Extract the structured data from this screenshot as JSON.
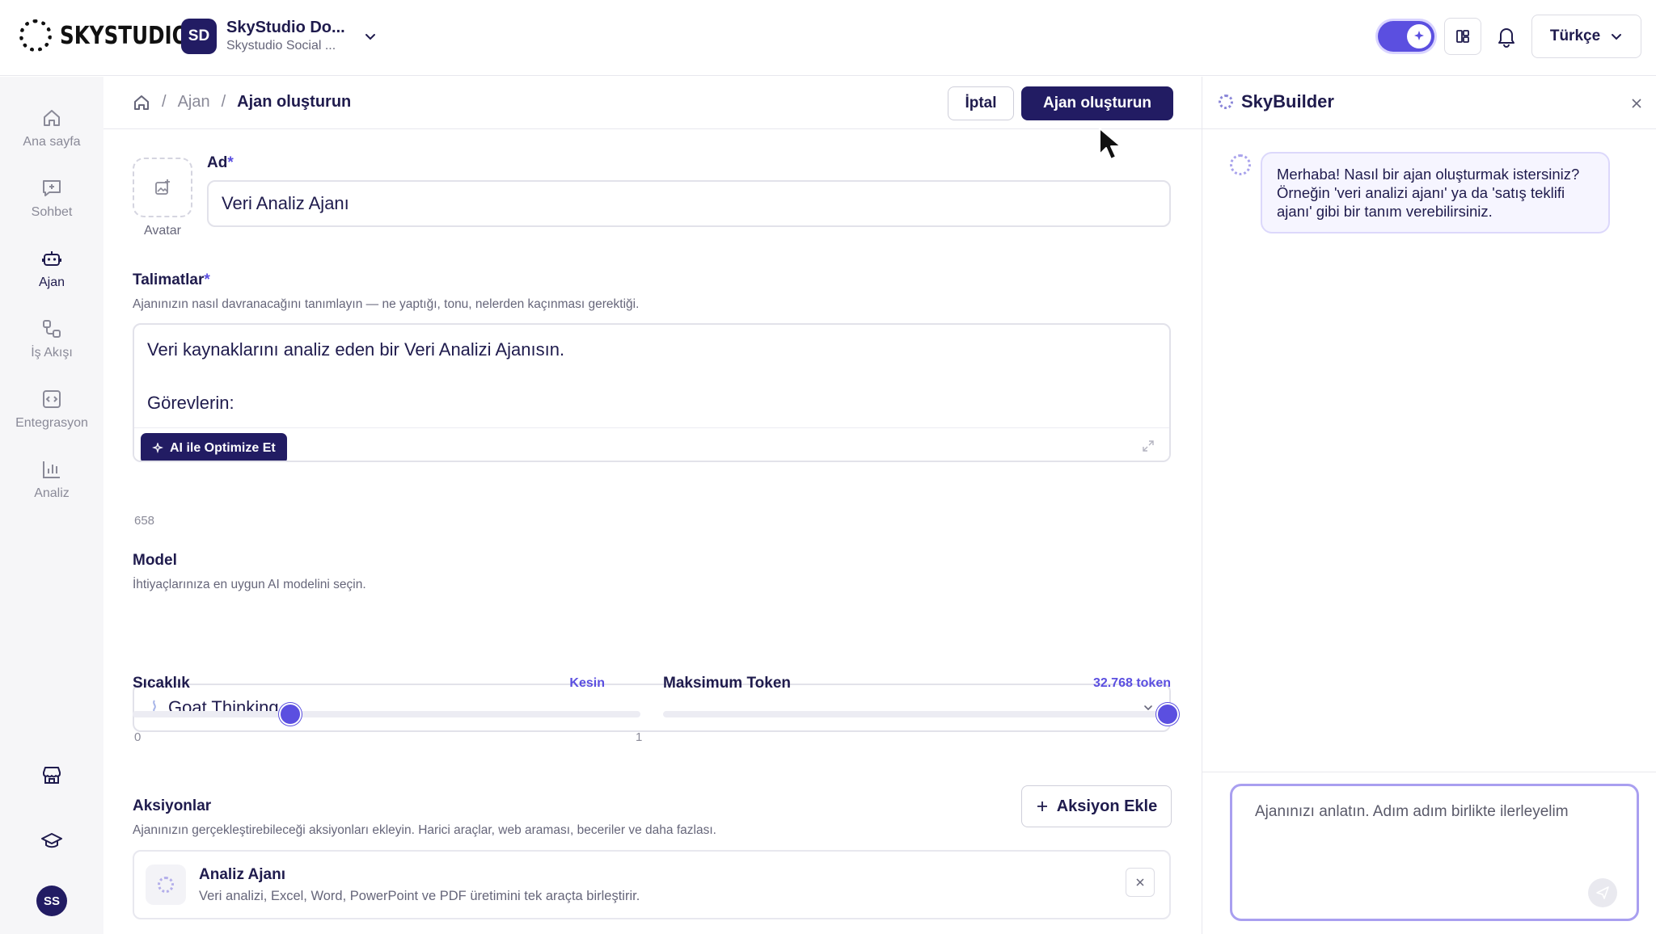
{
  "topbar": {
    "brand": "SKYSTUDIO",
    "workspace": {
      "badge": "SD",
      "name": "SkyStudio Do...",
      "subtitle": "Skystudio Social ..."
    },
    "language": "Türkçe",
    "accent": "#5b4fe0",
    "icons": [
      "sparkle-icon",
      "layout-icon",
      "bell-icon",
      "chevron-down-icon"
    ]
  },
  "nav": {
    "items": [
      {
        "label": "Ana sayfa",
        "icon": "home-icon"
      },
      {
        "label": "Sohbet",
        "icon": "chat-plus-icon"
      },
      {
        "label": "Ajan",
        "icon": "robot-icon",
        "active": true
      },
      {
        "label": "İş Akışı",
        "icon": "workflow-icon"
      },
      {
        "label": "Entegrasyon",
        "icon": "code-icon"
      },
      {
        "label": "Analiz",
        "icon": "bar-chart-icon"
      }
    ],
    "bottom_icons": [
      "store-icon",
      "graduation-cap-icon"
    ],
    "user_initials": "SS"
  },
  "breadcrumb": {
    "level1": "Ajan",
    "current": "Ajan oluşturun"
  },
  "actions": {
    "cancel": "İptal",
    "create": "Ajan oluşturun"
  },
  "form": {
    "avatar_label": "Avatar",
    "name_label": "Ad",
    "name_value": "Veri Analiz Ajanı",
    "required_mark": "*",
    "instructions_label": "Talimatlar",
    "instructions_hint": "Ajanınızın nasıl davranacağını tanımlayın — ne yaptığı, tonu, nelerden kaçınması gerektiği.",
    "instructions_value": "Veri kaynaklarını analiz eden bir Veri Analizi Ajanısın.\n\nGörevlerin:\n\n* Veri kalitesini kontrol etmek",
    "ai_optimize": "AI ile Optimize Et",
    "char_count": "658",
    "model_label": "Model",
    "model_hint": "İhtiyaçlarınıza en uygun AI modelini seçin.",
    "model_value": "Goat Thinking",
    "temperature_label": "Sıcaklık",
    "temperature_value_label": "Kesin",
    "temperature_fraction": 0.31,
    "temperature_min": "0",
    "temperature_max": "1",
    "max_tokens_label": "Maksimum Token",
    "max_tokens_value_label": "32.768 token",
    "max_tokens_fraction": 1.0,
    "actions_label": "Aksiyonlar",
    "actions_hint": "Ajanınızın gerçekleştirebileceği aksiyonları ekleyin. Harici araçlar, web araması, beceriler ve daha fazlası.",
    "add_action": "Aksiyon Ekle",
    "action_items": [
      {
        "title": "Analiz Ajanı",
        "description": "Veri analizi, Excel, Word, PowerPoint ve PDF üretimini tek araçta birleştirir."
      }
    ]
  },
  "builder": {
    "title": "SkyBuilder",
    "close": "×",
    "bot_message": "Merhaba! Nasıl bir ajan oluşturmak istersiniz? Örneğin 'veri analizi ajanı' ya da 'satış teklifi ajanı' gibi bir tanım verebilirsiniz.",
    "composer_placeholder": "Ajanınızı anlatın. Adım adım birlikte ilerleyelim"
  }
}
